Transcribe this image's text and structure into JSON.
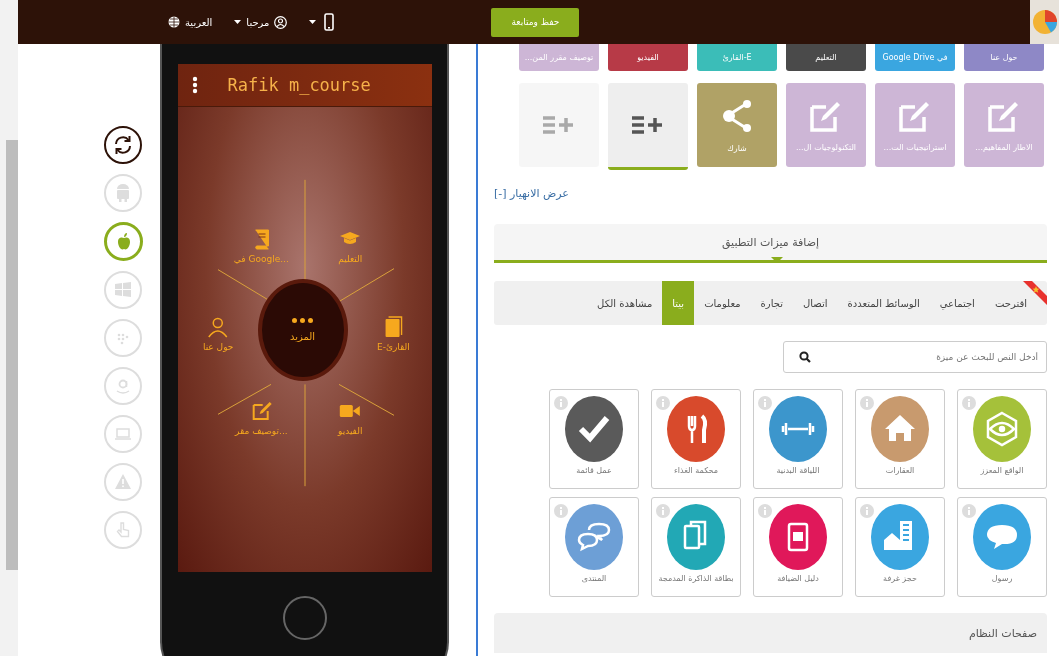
{
  "top_bar": {
    "language": "العربية",
    "user": "مرحبا",
    "save_button": "حفظ ومتابعة"
  },
  "platforms": [
    {
      "kind": "refresh",
      "selected": false
    },
    {
      "kind": "android",
      "selected": false
    },
    {
      "kind": "apple",
      "selected": true
    },
    {
      "kind": "windows",
      "selected": false
    },
    {
      "kind": "blackberry",
      "selected": false
    },
    {
      "kind": "amazon",
      "selected": false
    },
    {
      "kind": "laptop",
      "selected": false
    },
    {
      "kind": "warning",
      "selected": false
    },
    {
      "kind": "hand",
      "selected": false
    }
  ],
  "phone": {
    "title": "Rafik m_course",
    "center": "المزيد",
    "items": [
      {
        "kind": "cap",
        "label": "التعليم"
      },
      {
        "kind": "book",
        "label": "في Google..."
      },
      {
        "kind": "reader",
        "label": "E-القارئ"
      },
      {
        "kind": "person",
        "label": "حول عنا"
      },
      {
        "kind": "video",
        "label": "الفيديو"
      },
      {
        "kind": "edit",
        "label": "توصيف مقر..."
      }
    ]
  },
  "page_tabs": [
    {
      "label": "حول عنا",
      "color": "#8e88c6"
    },
    {
      "label": "في Google Drive",
      "color": "#3aa6e0"
    },
    {
      "label": "التعليم",
      "color": "#4a4a4a"
    },
    {
      "label": "E-القارئ",
      "color": "#3bbdb8"
    },
    {
      "label": "الفيديو",
      "color": "#b73a47"
    },
    {
      "label": "توصيف مقرر المن...",
      "color": "#cdb6d6"
    }
  ],
  "page_tiles": [
    {
      "kind": "edit",
      "label": "الاطار المفاهيم...",
      "selected": false,
      "disabled": false
    },
    {
      "kind": "edit",
      "label": "استراتيجيات الت...",
      "selected": false,
      "disabled": false
    },
    {
      "kind": "edit",
      "label": "التكنولوجيات ال...",
      "selected": false,
      "disabled": false
    },
    {
      "kind": "share",
      "label": "شارك",
      "selected": false,
      "disabled": false
    },
    {
      "kind": "add",
      "selected": true,
      "disabled": false
    },
    {
      "kind": "add",
      "selected": false,
      "disabled": true
    }
  ],
  "collapse_link": "[-] عرض الانهيار",
  "features_header": "إضافة ميزات التطبيق",
  "categories": [
    {
      "label": "اقترحت",
      "selected": false,
      "starred": true
    },
    {
      "label": "اجتماعي",
      "selected": false,
      "starred": false
    },
    {
      "label": "الوسائط المتعددة",
      "selected": false,
      "starred": false
    },
    {
      "label": "اتصال",
      "selected": false,
      "starred": false
    },
    {
      "label": "تجارة",
      "selected": false,
      "starred": false
    },
    {
      "label": "معلومات",
      "selected": false,
      "starred": false
    },
    {
      "label": "بيتا",
      "selected": true,
      "starred": false
    },
    {
      "label": "مشاهدة الكل",
      "selected": false,
      "starred": false
    }
  ],
  "search": {
    "placeholder": "أدخل النص للبحث عن ميزة"
  },
  "features": [
    {
      "kind": "ar",
      "label": "الواقع المعزز",
      "color": "#a5c13a"
    },
    {
      "kind": "house",
      "label": "العقارات",
      "color": "#c89a6e"
    },
    {
      "kind": "dumbbell",
      "label": "اللياقة البدنية",
      "color": "#3c96cc"
    },
    {
      "kind": "food",
      "label": "محكمة الغذاء",
      "color": "#d84a2c"
    },
    {
      "kind": "check",
      "label": "عمل قائمة",
      "color": "#5a5a5a"
    },
    {
      "kind": "chat",
      "label": "رسول",
      "color": "#3aa6e0"
    },
    {
      "kind": "building",
      "label": "حجز غرفة",
      "color": "#3aa6e0"
    },
    {
      "kind": "gift",
      "label": "دليل الضيافة",
      "color": "#e0185a"
    },
    {
      "kind": "cards",
      "label": "بطاقة الذاكرة المدمجة",
      "color": "#22a8b5"
    },
    {
      "kind": "forum",
      "label": "المنتدى",
      "color": "#6d9fd6"
    }
  ],
  "system_pages": "صفحات النظام"
}
